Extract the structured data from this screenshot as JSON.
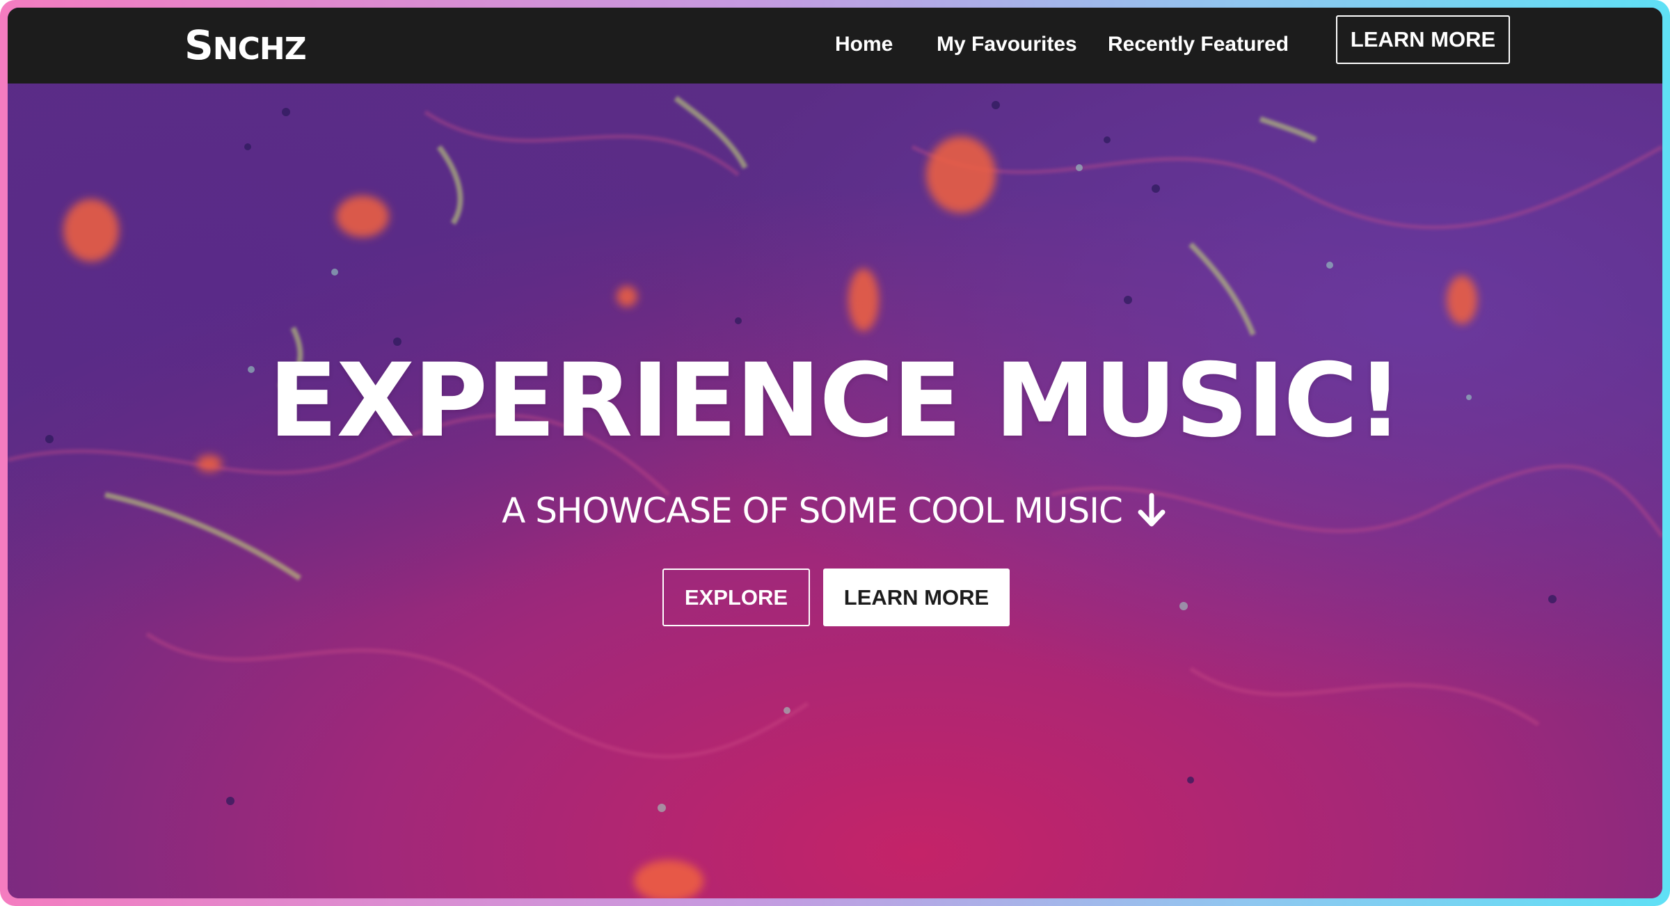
{
  "nav": {
    "brand": "SNCHZ",
    "brand_first": "S",
    "brand_rest": "NCHZ",
    "links": [
      {
        "label": "Home"
      },
      {
        "label": "My Favourites"
      },
      {
        "label": "Recently Featured"
      }
    ],
    "cta_label": "LEARN MORE"
  },
  "hero": {
    "title": "EXPERIENCE MUSIC!",
    "subtitle": "A SHOWCASE OF SOME COOL MUSIC",
    "subtitle_icon": "arrow-down-icon",
    "explore_label": "EXPLORE",
    "learn_label": "LEARN MORE",
    "background": "fluid-marble-art-image"
  },
  "colors": {
    "navbar_bg": "#1c1c1c",
    "text": "#ffffff",
    "hero_purple": "#5a2a7a",
    "hero_magenta": "#b8246e",
    "frame_gradient_start": "#f47cc0",
    "frame_gradient_end": "#5fe0f5"
  }
}
